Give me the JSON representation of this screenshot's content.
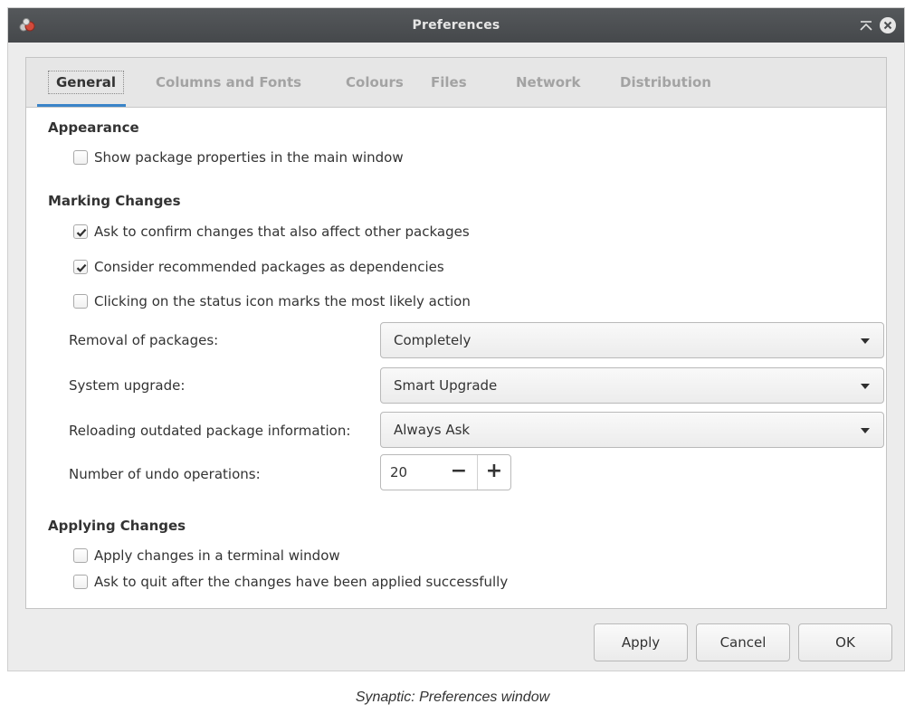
{
  "window": {
    "title": "Preferences"
  },
  "tabs": [
    {
      "label": "General",
      "active": true
    },
    {
      "label": "Columns and Fonts",
      "active": false
    },
    {
      "label": "Colours",
      "active": false
    },
    {
      "label": "Files",
      "active": false
    },
    {
      "label": "Network",
      "active": false
    },
    {
      "label": "Distribution",
      "active": false
    }
  ],
  "appearance": {
    "header": "Appearance",
    "show_properties": {
      "label": "Show package properties in the main window",
      "checked": false
    }
  },
  "marking": {
    "header": "Marking Changes",
    "ask_confirm": {
      "label": "Ask to confirm changes that also affect other packages",
      "checked": true
    },
    "recommended": {
      "label": "Consider recommended packages as dependencies",
      "checked": true
    },
    "status_icon": {
      "label": "Clicking on the status icon marks the most likely action",
      "checked": false
    },
    "removal": {
      "label": "Removal of packages:",
      "value": "Completely"
    },
    "upgrade": {
      "label": "System upgrade:",
      "value": "Smart Upgrade"
    },
    "reload": {
      "label": "Reloading outdated package information:",
      "value": "Always Ask"
    },
    "undo": {
      "label": "Number of undo operations:",
      "value": "20",
      "minus": "−",
      "plus": "+"
    }
  },
  "applying": {
    "header": "Applying Changes",
    "terminal": {
      "label": "Apply changes in a terminal window",
      "checked": false
    },
    "quit": {
      "label": "Ask to quit after the changes have been applied successfully",
      "checked": false
    }
  },
  "buttons": {
    "apply": "Apply",
    "cancel": "Cancel",
    "ok": "OK"
  },
  "caption": "Synaptic: Preferences window",
  "colors": {
    "titlebar": "#4d5053",
    "accent": "#3a84c8",
    "window_bg": "#ececec"
  }
}
